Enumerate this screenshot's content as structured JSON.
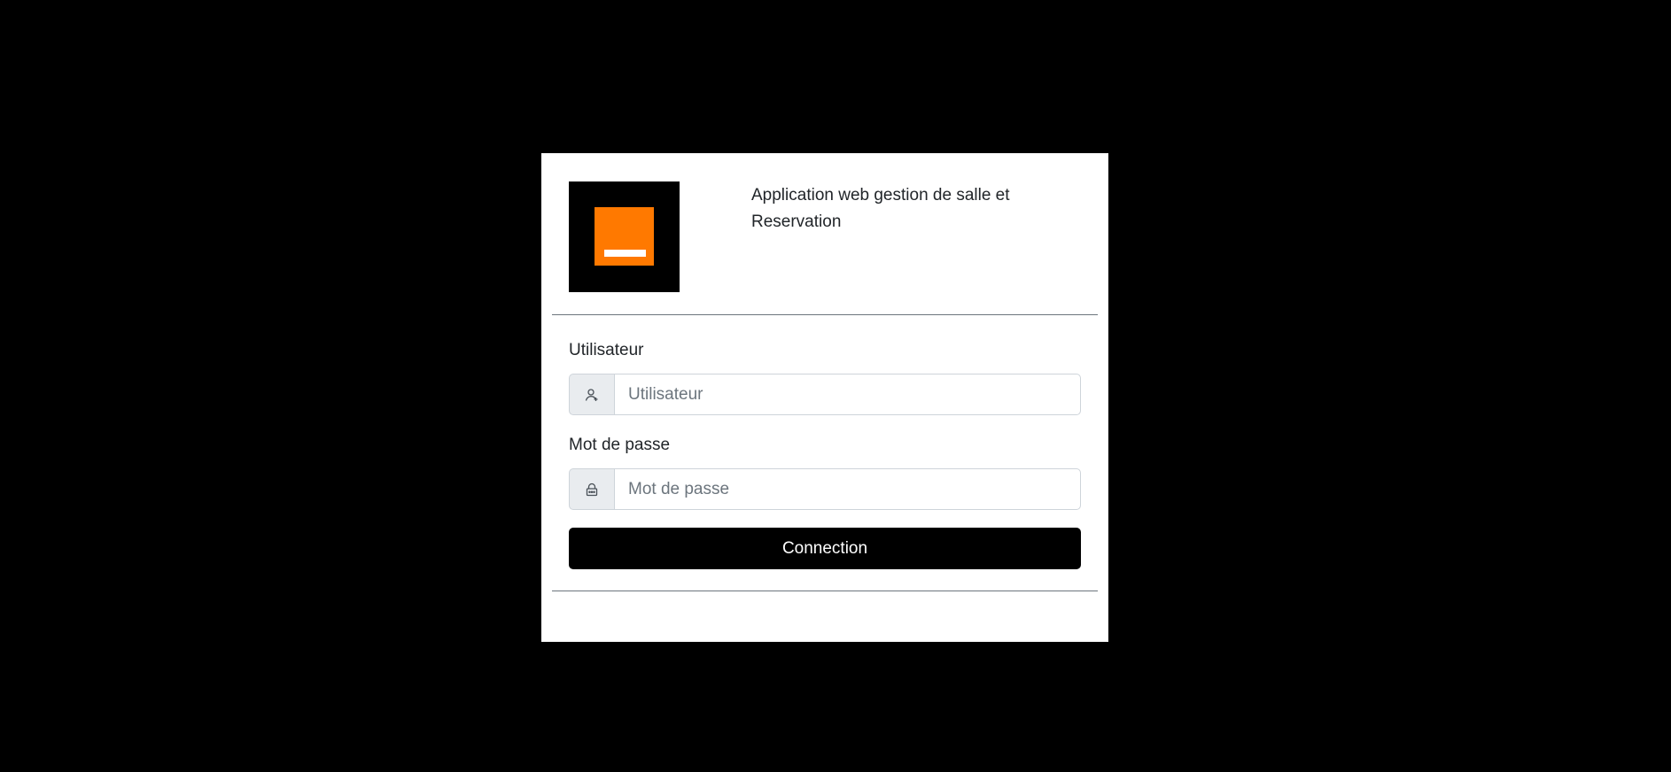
{
  "header": {
    "title": "Application web gestion de salle et Reservation",
    "logo_colors": {
      "background": "#000000",
      "square": "#ff7900",
      "bar": "#ffffff"
    }
  },
  "form": {
    "username": {
      "label": "Utilisateur",
      "placeholder": "Utilisateur",
      "value": "",
      "icon": "user-icon"
    },
    "password": {
      "label": "Mot de passe",
      "placeholder": "Mot de passe",
      "value": "",
      "icon": "lock-icon"
    },
    "submit_label": "Connection"
  },
  "colors": {
    "page_background": "#000000",
    "card_background": "#ffffff",
    "button_background": "#000000",
    "button_text": "#ffffff",
    "addon_background": "#e9ecef"
  }
}
